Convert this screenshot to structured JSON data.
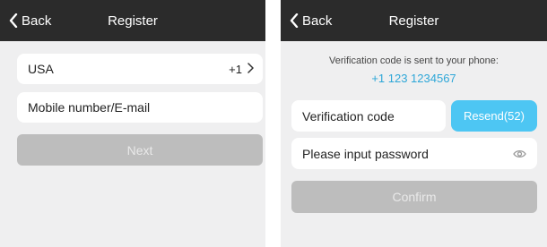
{
  "left_screen": {
    "header": {
      "back_label": "Back",
      "title": "Register"
    },
    "country": {
      "name": "USA",
      "code": "+1"
    },
    "account_input": {
      "placeholder": "Mobile number/E-mail"
    },
    "next_button": {
      "label": "Next",
      "enabled": false
    }
  },
  "right_screen": {
    "header": {
      "back_label": "Back",
      "title": "Register"
    },
    "info": {
      "message": "Verification code is sent to your phone:",
      "phone": "+1 123 1234567"
    },
    "code_input": {
      "placeholder": "Verification code"
    },
    "resend_button": {
      "label": "Resend(52)"
    },
    "password_input": {
      "placeholder": "Please input password"
    },
    "confirm_button": {
      "label": "Confirm",
      "enabled": false
    }
  },
  "icons": {
    "back": "chevron-left-icon",
    "country_arrow": "chevron-right-icon",
    "password_toggle": "eye-icon"
  },
  "colors": {
    "header_bg": "#2b2b2b",
    "page_bg": "#efeff0",
    "accent": "#4dc6f3",
    "phone_text": "#2ea7d8",
    "disabled_button": "#bdbdbd"
  }
}
